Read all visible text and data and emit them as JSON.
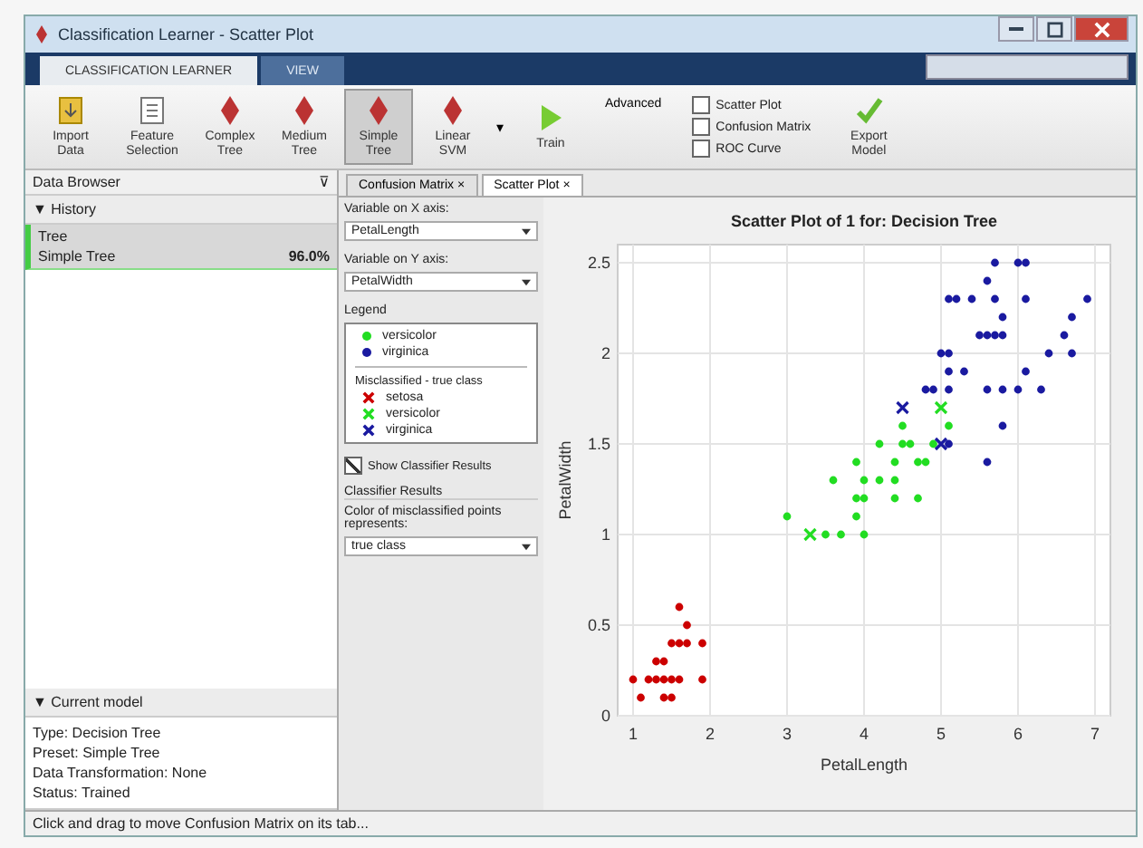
{
  "window": {
    "title": "Classification Learner - Scatter Plot"
  },
  "ribbon_tabs": [
    {
      "label": "CLASSIFICATION LEARNER",
      "selected": true
    },
    {
      "label": "VIEW",
      "selected": false
    }
  ],
  "ribbon_items": [
    {
      "kind": "import",
      "label": "Import Data"
    },
    {
      "kind": "features",
      "label": "Feature Selection"
    },
    {
      "kind": "tree",
      "label": "Complex Tree",
      "selected": false
    },
    {
      "kind": "tree",
      "label": "Medium Tree",
      "selected": false
    },
    {
      "kind": "tree",
      "label": "Simple Tree",
      "selected": true
    },
    {
      "kind": "tree",
      "label": "Linear SVM",
      "selected": false
    },
    {
      "kind": "more",
      "label": "▾"
    },
    {
      "kind": "train",
      "label": "Train"
    },
    {
      "kind": "link",
      "label": "Advanced"
    },
    {
      "kind": "checks",
      "options": [
        {
          "label": "Scatter Plot",
          "checked": false
        },
        {
          "label": "Confusion Matrix",
          "checked": false
        },
        {
          "label": "ROC Curve",
          "checked": false
        }
      ]
    },
    {
      "kind": "export",
      "label": "Export Model"
    }
  ],
  "data_browser": {
    "title": "Data Browser",
    "pin": "⊽",
    "history": {
      "label": "▼ History",
      "items": [
        {
          "group": "Tree",
          "name": "Simple Tree",
          "accuracy": "96.0%",
          "selected": true
        }
      ]
    },
    "current_model": {
      "label": "▼ Current model",
      "lines": [
        "Type: Decision Tree",
        "Preset: Simple Tree",
        "Data Transformation: None",
        "Status: Trained"
      ]
    }
  },
  "doc_tabs": [
    {
      "label": "Confusion Matrix",
      "close": "×",
      "selected": false
    },
    {
      "label": "Scatter Plot",
      "close": "×",
      "selected": true
    }
  ],
  "options": {
    "x_label": "Variable on X axis:",
    "x_value": "PetalLength",
    "y_label": "Variable on Y axis:",
    "y_value": "PetalWidth",
    "legend_title": "Legend",
    "legend": [
      {
        "kind": "dot",
        "label": "versicolor",
        "color": "#22dd22"
      },
      {
        "kind": "dot",
        "label": "virginica",
        "color": "#1a1aa0"
      }
    ],
    "misclassified_title": "Misclassified - true class",
    "misclassified": [
      {
        "kind": "cross",
        "label": "setosa",
        "color": "#cc0000"
      },
      {
        "kind": "cross",
        "label": "versicolor",
        "color": "#22dd22"
      },
      {
        "kind": "cross",
        "label": "virginica",
        "color": "#1a1aa0"
      }
    ],
    "show_results": {
      "label": "Show Classifier Results",
      "checked": true
    },
    "results_title": "Classifier Results",
    "results_text": "Color of misclassified points represents:",
    "results_value": "true class"
  },
  "plot": {
    "chart_data": {
      "type": "scatter",
      "title": "Scatter Plot of 1 for: Decision Tree",
      "xlabel": "PetalLength",
      "ylabel": "PetalWidth",
      "xlim": [
        0.8,
        7.2
      ],
      "ylim": [
        0,
        2.6
      ],
      "xticks": [
        1,
        2,
        3,
        4,
        5,
        6,
        7
      ],
      "yticks": [
        0,
        0.5,
        1,
        1.5,
        2,
        2.5
      ],
      "grid": true,
      "series": [
        {
          "color": "#cc0000",
          "marker": "dot",
          "x": [
            1.4,
            1.3,
            1.5,
            1.4,
            1.7,
            1.5,
            1.6,
            1.1,
            1.2,
            1.9,
            1.6,
            1.7,
            1.0,
            1.9,
            1.5,
            1.3,
            1.6,
            1.4
          ],
          "values": [
            0.2,
            0.2,
            0.2,
            0.3,
            0.4,
            0.1,
            0.2,
            0.1,
            0.2,
            0.4,
            0.6,
            0.5,
            0.2,
            0.2,
            0.4,
            0.3,
            0.4,
            0.1
          ]
        },
        {
          "color": "#22dd22",
          "marker": "dot",
          "x": [
            3.0,
            3.5,
            3.7,
            4.0,
            3.9,
            3.6,
            3.9,
            4.0,
            4.2,
            4.4,
            4.5,
            4.7,
            4.6,
            4.7,
            4.2,
            4.4,
            4.8,
            4.9,
            5.1,
            4.0,
            4.4,
            3.9,
            4.5
          ],
          "values": [
            1.1,
            1.0,
            1.0,
            1.0,
            1.1,
            1.3,
            1.4,
            1.3,
            1.3,
            1.3,
            1.5,
            1.4,
            1.5,
            1.2,
            1.5,
            1.4,
            1.4,
            1.5,
            1.6,
            1.2,
            1.2,
            1.2,
            1.6
          ]
        },
        {
          "color": "#1a1aa0",
          "marker": "dot",
          "x": [
            4.8,
            4.9,
            5.0,
            5.1,
            5.1,
            5.1,
            5.3,
            5.1,
            5.2,
            5.4,
            5.6,
            5.7,
            6.0,
            6.1,
            5.8,
            6.1,
            5.6,
            5.7,
            5.8,
            5.5,
            6.6,
            6.7,
            6.9,
            6.7,
            6.4,
            6.1,
            5.6,
            5.8,
            6.0,
            6.3,
            5.8,
            5.6,
            5.1,
            5.7
          ],
          "values": [
            1.8,
            1.8,
            2.0,
            2.0,
            1.8,
            1.9,
            1.9,
            2.3,
            2.3,
            2.3,
            2.4,
            2.5,
            2.5,
            2.5,
            2.2,
            2.3,
            2.1,
            2.1,
            2.1,
            2.1,
            2.1,
            2.2,
            2.3,
            2.0,
            2.0,
            1.9,
            1.8,
            1.8,
            1.8,
            1.8,
            1.6,
            1.4,
            1.5,
            2.3
          ]
        },
        {
          "color": "#22dd22",
          "marker": "cross",
          "x": [
            3.3,
            5.0
          ],
          "values": [
            1.0,
            1.7
          ]
        },
        {
          "color": "#1a1aa0",
          "marker": "cross",
          "x": [
            4.5,
            5.0
          ],
          "values": [
            1.7,
            1.5
          ]
        }
      ]
    }
  },
  "status_bar": "Click and drag to move Confusion Matrix on its tab..."
}
